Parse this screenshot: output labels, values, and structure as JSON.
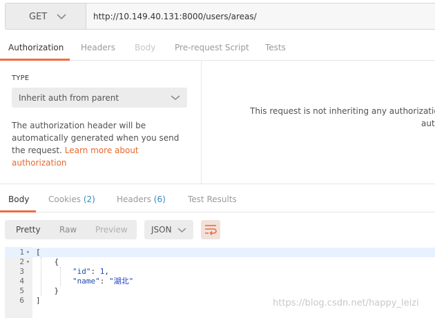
{
  "request": {
    "method": "GET",
    "url": "http://10.149.40.131:8000/users/areas/"
  },
  "request_tabs": [
    {
      "label": "Authorization",
      "state": "active"
    },
    {
      "label": "Headers",
      "state": "normal"
    },
    {
      "label": "Body",
      "state": "disabled"
    },
    {
      "label": "Pre-request Script",
      "state": "normal"
    },
    {
      "label": "Tests",
      "state": "normal"
    }
  ],
  "auth": {
    "type_label": "TYPE",
    "type_value": "Inherit auth from parent",
    "description_prefix": "The authorization header will be automatically generated when you send the request.",
    "learn_more_link": "Learn more about authorization",
    "message_line1": "This request is not inheriting any authorization h",
    "message_line2": "auth"
  },
  "response_tabs": [
    {
      "label": "Body",
      "count": "",
      "state": "active"
    },
    {
      "label": "Cookies",
      "count": "(2)",
      "state": "normal"
    },
    {
      "label": "Headers",
      "count": "(6)",
      "state": "normal"
    },
    {
      "label": "Test Results",
      "count": "",
      "state": "normal"
    }
  ],
  "response_toolbar": {
    "views": [
      {
        "label": "Pretty",
        "state": "active"
      },
      {
        "label": "Raw",
        "state": "normal"
      },
      {
        "label": "Preview",
        "state": "disabled"
      }
    ],
    "format": "JSON",
    "wrap_icon": "wrap-lines-icon"
  },
  "response_body": {
    "lines": [
      {
        "num": "1",
        "fold": "▾",
        "text": "["
      },
      {
        "num": "2",
        "fold": "▾",
        "text": "    {"
      },
      {
        "num": "3",
        "fold": "",
        "key": "\"id\"",
        "sep": ": ",
        "value": "1",
        "tail": ","
      },
      {
        "num": "4",
        "fold": "",
        "key": "\"name\"",
        "sep": ": ",
        "value": "\"湖北\"",
        "tail": ""
      },
      {
        "num": "5",
        "fold": "",
        "text": "    }"
      },
      {
        "num": "6",
        "fold": "",
        "text": "]"
      }
    ]
  },
  "watermark": "https://blog.csdn.net/happy_leizi",
  "colors": {
    "accent": "#f26b3a",
    "link": "#e6682e",
    "count": "#2f8ac4"
  }
}
